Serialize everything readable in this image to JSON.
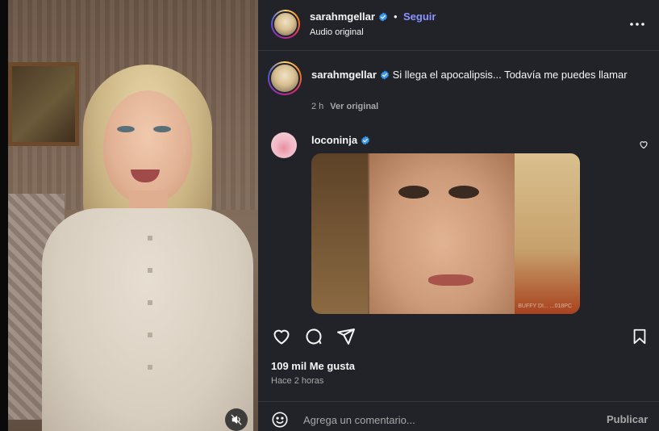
{
  "post": {
    "author": "sarahmgellar",
    "follow_label": "Seguir",
    "separator": "•",
    "audio_label": "Audio original",
    "caption_user": "sarahmgellar",
    "caption_text": "Si llega el apocalipsis... Todavía me puedes llamar",
    "caption_time": "2 h",
    "see_original_label": "Ver original"
  },
  "comment": {
    "user": "loconinja",
    "gif_watermark": "BUFFY DI... ...018PC"
  },
  "stats": {
    "likes": "109 mil Me gusta",
    "time_ago": "Hace 2 horas"
  },
  "composer": {
    "placeholder": "Agrega un comentario...",
    "publish_label": "Publicar"
  },
  "icons": {
    "verified": "verified-badge-icon",
    "more": "more-options-icon",
    "like": "heart-icon",
    "comment": "comment-bubble-icon",
    "share": "paper-plane-icon",
    "save": "bookmark-icon",
    "emoji": "emoji-icon",
    "mute": "muted-speaker-icon"
  },
  "colors": {
    "panel_bg": "#212328",
    "link_accent": "#8b93ff",
    "verified_blue": "#3897f0",
    "muted_text": "#a8a8a8"
  }
}
